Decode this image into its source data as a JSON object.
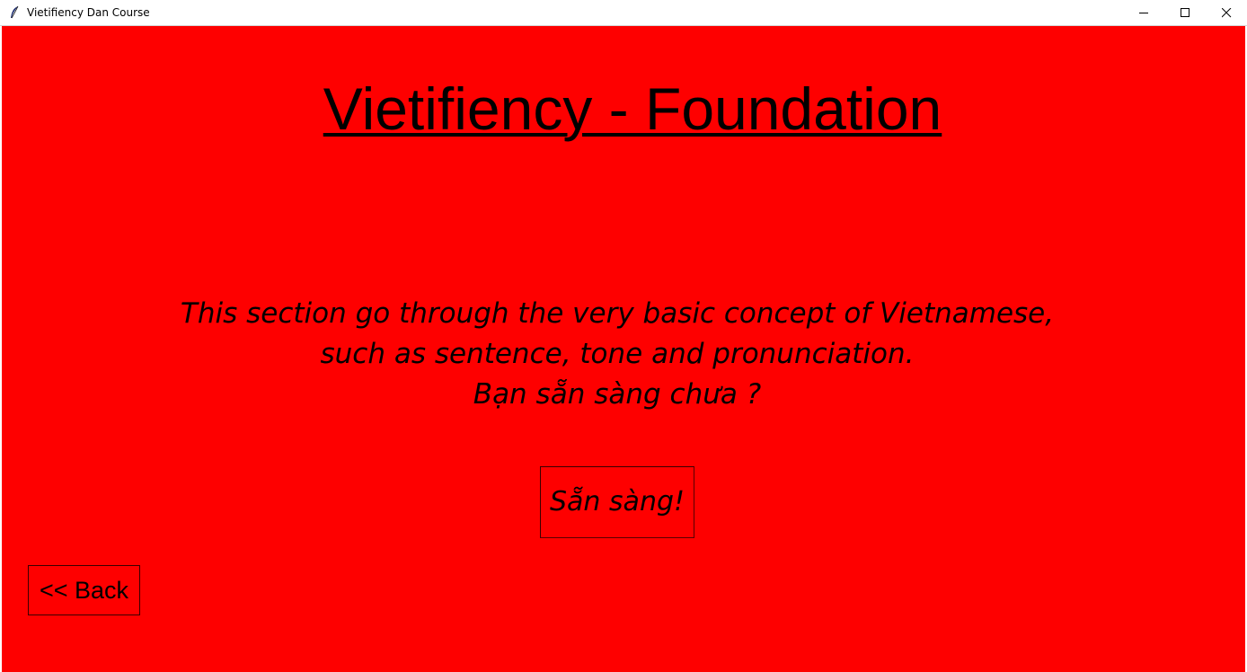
{
  "window": {
    "title": "Vietifiency Dan Course",
    "app_icon": "feather-icon",
    "controls": {
      "minimize_icon": "minimize-icon",
      "maximize_icon": "maximize-icon",
      "close_icon": "close-icon"
    }
  },
  "colors": {
    "background": "#fe0000",
    "text": "#000000",
    "titlebar": "#ffffff"
  },
  "main": {
    "heading": "Vietifiency - Foundation",
    "description_lines": [
      "This section go through the very basic concept of Vietnamese,",
      "such as sentence, tone and pronunciation.",
      "Bạn sẵn sàng chưa ?"
    ],
    "ready_button_label": "Sẵn sàng!",
    "back_button_label": "<< Back"
  }
}
